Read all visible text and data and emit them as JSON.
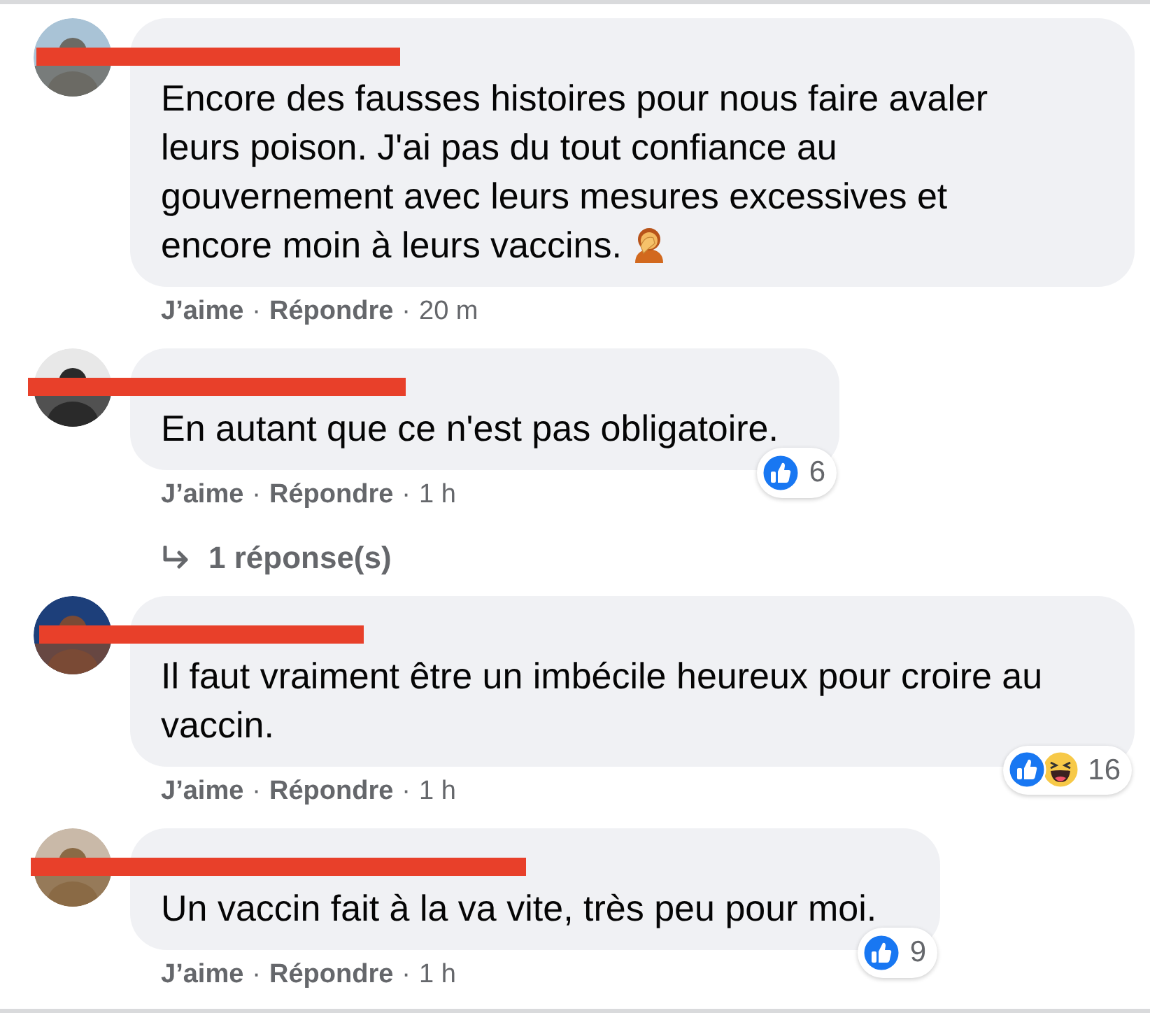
{
  "separator": "·",
  "comments": [
    {
      "name_redacted": true,
      "text": "Encore des fausses histoires pour nous faire avaler leurs poison. J'ai pas du tout confiance au gouvernement avec leurs mesures excessives et encore moin à leurs vaccins.",
      "facepalm_emoji": true,
      "actions": [
        "J’aime",
        "Répondre"
      ],
      "time": "20 m"
    },
    {
      "name_redacted": true,
      "text": "En autant que ce n'est pas obligatoire.",
      "actions": [
        "J’aime",
        "Répondre"
      ],
      "time": "1 h",
      "reactions": {
        "like": true,
        "count": "6"
      },
      "replies": "1 réponse(s)"
    },
    {
      "name_redacted": true,
      "text": "Il faut vraiment être un imbécile heureux pour croire au vaccin.",
      "actions": [
        "J’aime",
        "Répondre"
      ],
      "time": "1 h",
      "reactions": {
        "like": true,
        "haha": true,
        "count": "16"
      }
    },
    {
      "name_redacted": true,
      "text": "Un vaccin fait à la va vite, très peu pour moi.",
      "actions": [
        "J’aime",
        "Répondre"
      ],
      "time": "1 h",
      "reactions": {
        "like": true,
        "count": "9"
      }
    }
  ]
}
